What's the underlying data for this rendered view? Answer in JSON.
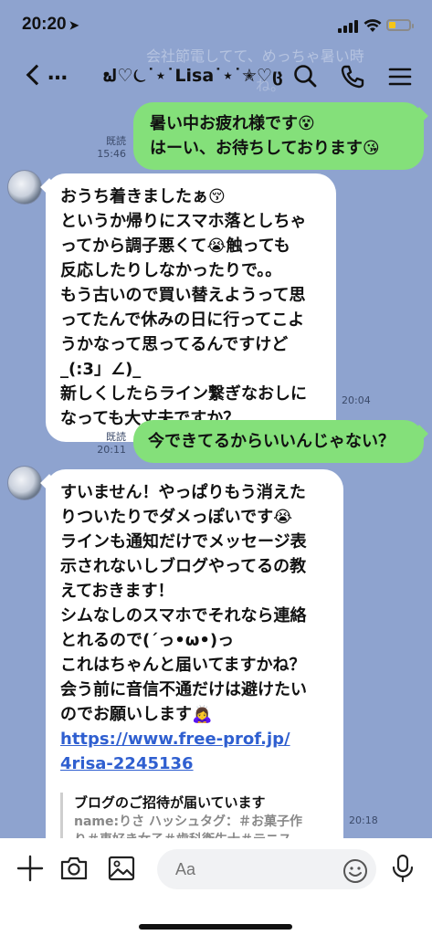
{
  "status_bar": {
    "time": "20:20",
    "location_arrow": "➤",
    "battery_fraction": 0.35
  },
  "background_notification": {
    "line1": "会社節電してて、めっちゃ暑い時",
    "line2": "ね。"
  },
  "header": {
    "title": "ຟ♡⏾˙⋆˙Lisa˙⋆˙✭♡ც",
    "back_dots": "…"
  },
  "messages": [
    {
      "direction": "out",
      "read_label": "既読",
      "time": "15:46",
      "lines": [
        "暑い中お疲れ様です😵",
        "はーい、お待ちしております😘"
      ]
    },
    {
      "direction": "in",
      "time": "20:04",
      "lines": [
        "おうち着きましたぁ😚",
        "というか帰りにスマホ落としちゃ",
        "ってから調子悪くて😭触っても",
        "反応したりしなかったりで。。",
        "もう古いので買い替えようって思",
        "ってたんで休みの日に行ってこよ",
        "うかなって思ってるんですけど",
        "_(:3」∠)_",
        "新しくしたらライン繋ぎなおしに",
        "なっても大丈夫ですか？"
      ]
    },
    {
      "direction": "out",
      "read_label": "既読",
      "time": "20:11",
      "lines": [
        "今できてるからいいんじゃない？"
      ]
    },
    {
      "direction": "in",
      "time": "20:18",
      "lines": [
        "すいません！やっぱりもう消えた",
        "りついたりでダメっぽいです😭",
        "ラインも通知だけでメッセージ表",
        "示されないしブログやってるの教",
        "えておきます！",
        "シムなしのスマホでそれなら連絡",
        "とれるので(´っ•ω•)っ",
        "これはちゃんと届いてますかね？",
        "会う前に音信不通だけは避けたい",
        "のでお願いします🙇‍♀️"
      ],
      "link_lines": [
        "https://www.free-prof.jp/",
        "4risa-2245136"
      ],
      "preview": {
        "title": "ブログのご招待が届いています",
        "body_line1": "name:りさ ハッシュタグ：＃お菓子作",
        "body_line2": "り＃車好き女子＃歯科衛生士＃テニス…"
      }
    }
  ],
  "input_bar": {
    "placeholder": "Aa",
    "icons": [
      "plus-icon",
      "camera-icon",
      "image-icon",
      "emoji-icon",
      "microphone-icon"
    ]
  },
  "colors": {
    "background": "#8ea3cf",
    "outgoing_bubble": "#84e07a",
    "incoming_bubble": "#ffffff",
    "link": "#2f5fd0"
  }
}
